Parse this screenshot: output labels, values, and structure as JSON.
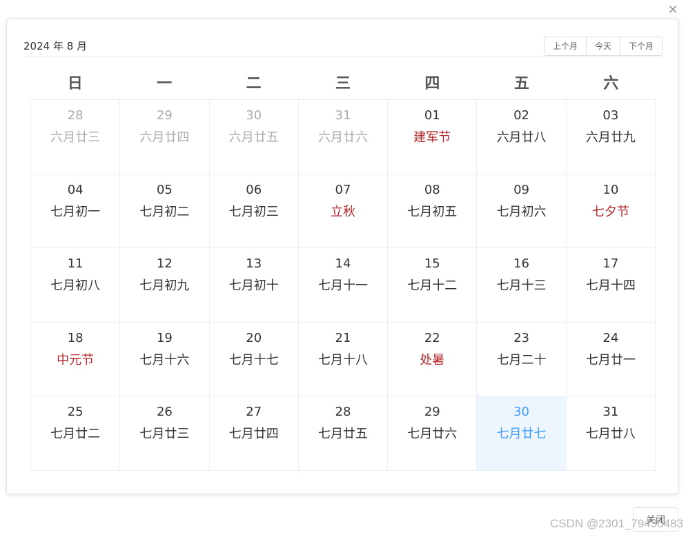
{
  "dialog": {
    "close_icon": "close-icon",
    "close_glyph": "✕",
    "close_button_label": "关闭"
  },
  "header": {
    "title": "2024 年 8 月",
    "prev_month_label": "上个月",
    "today_label": "今天",
    "next_month_label": "下个月"
  },
  "weekdays": [
    "日",
    "一",
    "二",
    "三",
    "四",
    "五",
    "六"
  ],
  "colors": {
    "festival": "#b4282d",
    "selected_bg": "#edf5ff",
    "selected_text": "#409eff",
    "other_month_text": "#aaaaaa"
  },
  "days": [
    {
      "day": "28",
      "lunar": "六月廿三",
      "other_month": true
    },
    {
      "day": "29",
      "lunar": "六月廿四",
      "other_month": true
    },
    {
      "day": "30",
      "lunar": "六月廿五",
      "other_month": true
    },
    {
      "day": "31",
      "lunar": "六月廿六",
      "other_month": true
    },
    {
      "day": "01",
      "lunar": "建军节",
      "festival": true
    },
    {
      "day": "02",
      "lunar": "六月廿八"
    },
    {
      "day": "03",
      "lunar": "六月廿九"
    },
    {
      "day": "04",
      "lunar": "七月初一"
    },
    {
      "day": "05",
      "lunar": "七月初二"
    },
    {
      "day": "06",
      "lunar": "七月初三"
    },
    {
      "day": "07",
      "lunar": "立秋",
      "festival": true
    },
    {
      "day": "08",
      "lunar": "七月初五"
    },
    {
      "day": "09",
      "lunar": "七月初六"
    },
    {
      "day": "10",
      "lunar": "七夕节",
      "festival": true
    },
    {
      "day": "11",
      "lunar": "七月初八"
    },
    {
      "day": "12",
      "lunar": "七月初九"
    },
    {
      "day": "13",
      "lunar": "七月初十"
    },
    {
      "day": "14",
      "lunar": "七月十一"
    },
    {
      "day": "15",
      "lunar": "七月十二"
    },
    {
      "day": "16",
      "lunar": "七月十三"
    },
    {
      "day": "17",
      "lunar": "七月十四"
    },
    {
      "day": "18",
      "lunar": "中元节",
      "festival": true
    },
    {
      "day": "19",
      "lunar": "七月十六"
    },
    {
      "day": "20",
      "lunar": "七月十七"
    },
    {
      "day": "21",
      "lunar": "七月十八"
    },
    {
      "day": "22",
      "lunar": "处暑",
      "festival": true
    },
    {
      "day": "23",
      "lunar": "七月二十"
    },
    {
      "day": "24",
      "lunar": "七月廿一"
    },
    {
      "day": "25",
      "lunar": "七月廿二"
    },
    {
      "day": "26",
      "lunar": "七月廿三"
    },
    {
      "day": "27",
      "lunar": "七月廿四"
    },
    {
      "day": "28",
      "lunar": "七月廿五"
    },
    {
      "day": "29",
      "lunar": "七月廿六"
    },
    {
      "day": "30",
      "lunar": "七月廿七",
      "selected": true
    },
    {
      "day": "31",
      "lunar": "七月廿八"
    }
  ],
  "watermark": "CSDN @2301_79430483"
}
